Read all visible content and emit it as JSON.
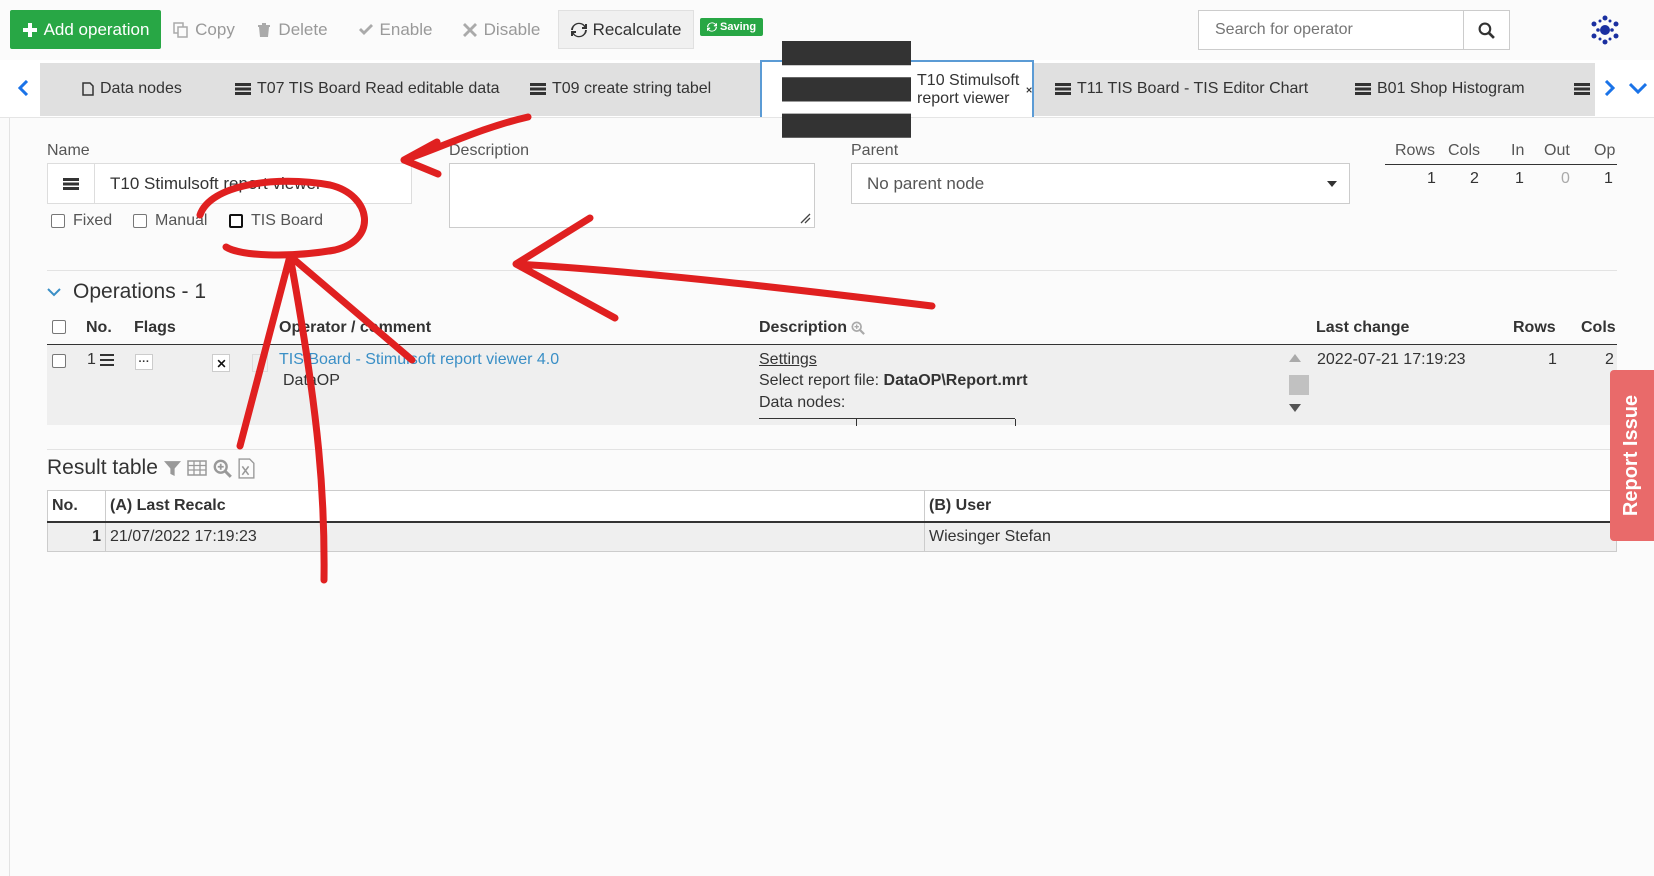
{
  "toolbar": {
    "add_label": "Add operation",
    "copy_label": "Copy",
    "delete_label": "Delete",
    "enable_label": "Enable",
    "disable_label": "Disable",
    "recalc_label": "Recalculate",
    "saving_badge": "Saving"
  },
  "search": {
    "placeholder": "Search for operator"
  },
  "tabs": [
    {
      "label": "Data nodes"
    },
    {
      "label": "T07 TIS Board Read editable data"
    },
    {
      "label": "T09 create string tabel"
    },
    {
      "label": "T10 Stimulsoft report viewer",
      "active": true
    },
    {
      "label": "T11 TIS Board - TIS Editor Chart"
    },
    {
      "label": "B01 Shop Histogram"
    }
  ],
  "form": {
    "name_label": "Name",
    "name_value": "T10 Stimulsoft report viewer",
    "description_label": "Description",
    "parent_label": "Parent",
    "parent_value": "No parent node",
    "fixed_label": "Fixed",
    "manual_label": "Manual",
    "tisboard_label": "TIS Board"
  },
  "stats": {
    "headers": [
      "Rows",
      "Cols",
      "In",
      "Out",
      "Op"
    ],
    "values": [
      "1",
      "2",
      "1",
      "0",
      "1"
    ]
  },
  "operations": {
    "title": "Operations - 1",
    "headers": {
      "no": "No.",
      "flags": "Flags",
      "operator": "Operator / comment",
      "description": "Description",
      "last_change": "Last change",
      "rows": "Rows",
      "cols": "Cols"
    },
    "rows": [
      {
        "no": "1",
        "operator": "TIS Board - Stimulsoft report viewer 4.0",
        "comment": "DataOP",
        "settings": "Settings",
        "report_label": "Select report file:",
        "report_file": "DataOP\\Report.mrt",
        "data_nodes_label": "Data nodes:",
        "last_change": "2022-07-21 17:19:23",
        "rows": "1",
        "cols": "2"
      }
    ]
  },
  "result": {
    "title": "Result table",
    "headers": [
      "No.",
      "(A) Last Recalc",
      "(B) User"
    ],
    "rows": [
      [
        "1",
        "21/07/2022 17:19:23",
        "Wiesinger Stefan"
      ]
    ]
  },
  "report_issue": "Report Issue",
  "colors": {
    "green": "#28a745",
    "link": "#3a8fc6",
    "annotation": "#e02020",
    "report": "#e96a6a"
  }
}
